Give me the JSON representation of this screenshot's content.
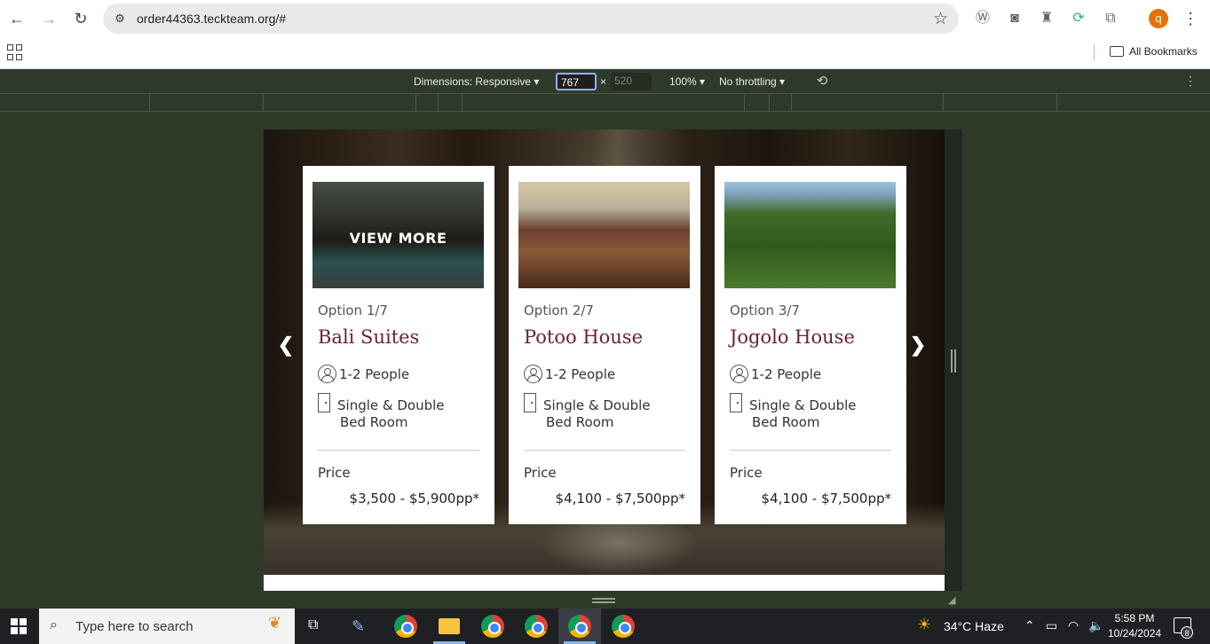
{
  "browser": {
    "url": "order44363.teckteam.org/#",
    "bookmarks_label": "All Bookmarks",
    "avatar_letter": "q"
  },
  "devtools": {
    "dimensions_label": "Dimensions: Responsive",
    "width_value": "767",
    "height_value": "520",
    "zoom": "100%",
    "throttling": "No throttling"
  },
  "carousel": {
    "cards": [
      {
        "option": "Option 1/7",
        "title": "Bali Suites",
        "overlay": "VIEW MORE",
        "people": "1-2 People",
        "room_line1": "Single & Double",
        "room_line2": "Bed Room",
        "price_label": "Price",
        "price": "$3,500 - $5,900pp*"
      },
      {
        "option": "Option 2/7",
        "title": "Potoo House",
        "people": "1-2 People",
        "room_line1": "Single & Double",
        "room_line2": "Bed Room",
        "price_label": "Price",
        "price": "$4,100 - $7,500pp*"
      },
      {
        "option": "Option 3/7",
        "title": "Jogolo House",
        "people": "1-2 People",
        "room_line1": "Single & Double",
        "room_line2": "Bed Room",
        "price_label": "Price",
        "price": "$4,100 - $7,500pp*"
      }
    ]
  },
  "taskbar": {
    "search_placeholder": "Type here to search",
    "weather": "34°C  Haze",
    "time": "5:58 PM",
    "date": "10/24/2024",
    "notification_count": "8",
    "weather_badge": "1"
  },
  "colors": {
    "card_title": "#6b1f3a",
    "page_bg": "#2c3a27",
    "avatar": "#e8710a"
  }
}
